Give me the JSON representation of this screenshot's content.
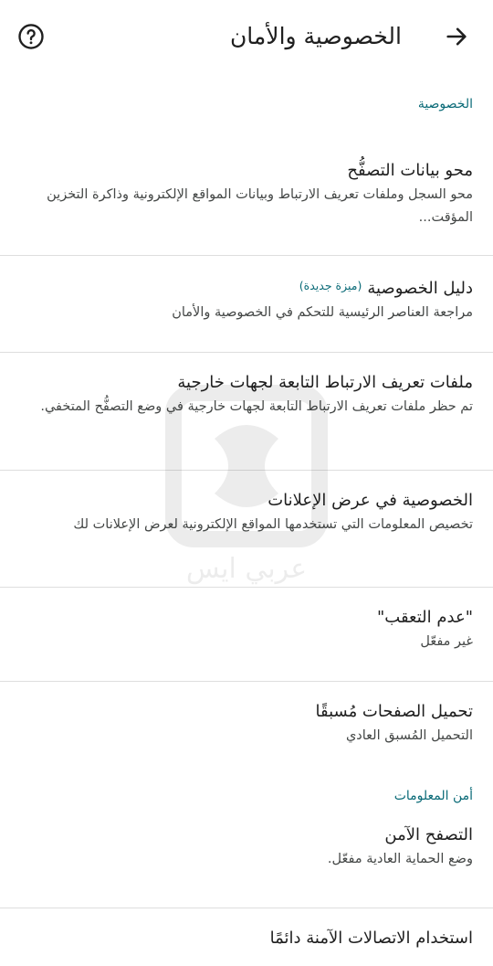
{
  "header": {
    "title": "الخصوصية والأمان",
    "back_icon": "arrow-right-icon",
    "help_icon": "help-circle-icon"
  },
  "sections": {
    "privacy": {
      "label": "الخصوصية",
      "items": [
        {
          "title": "محو بيانات التصفُّح",
          "subtitle": "محو السجل وملفات تعريف الارتباط وبيانات المواقع الإلكترونية وذاكرة التخزين المؤقت..."
        },
        {
          "title": "دليل الخصوصية",
          "badge": "(ميزة جديدة)",
          "subtitle": "مراجعة العناصر الرئيسية للتحكم في الخصوصية والأمان"
        },
        {
          "title": "ملفات تعريف الارتباط التابعة لجهات خارجية",
          "subtitle": "تم حظر ملفات تعريف الارتباط التابعة لجهات خارجية في وضع التصفُّح المتخفي."
        },
        {
          "title": "الخصوصية في عرض الإعلانات",
          "subtitle": "تخصيص المعلومات التي تستخدمها المواقع الإلكترونية لعرض الإعلانات لك"
        },
        {
          "title": "\"عدم التعقب\"",
          "subtitle": "غير مفعّل"
        },
        {
          "title": "تحميل الصفحات مُسبقًا",
          "subtitle": "التحميل المُسبق العادي"
        }
      ]
    },
    "security": {
      "label": "أمن المعلومات",
      "items": [
        {
          "title": "التصفح الآمن",
          "subtitle": "وضع الحماية العادية مفعّل."
        },
        {
          "title": "استخدام الاتصالات الآمنة دائمًا"
        }
      ]
    }
  },
  "watermark": {
    "text": "عربي ايس"
  }
}
